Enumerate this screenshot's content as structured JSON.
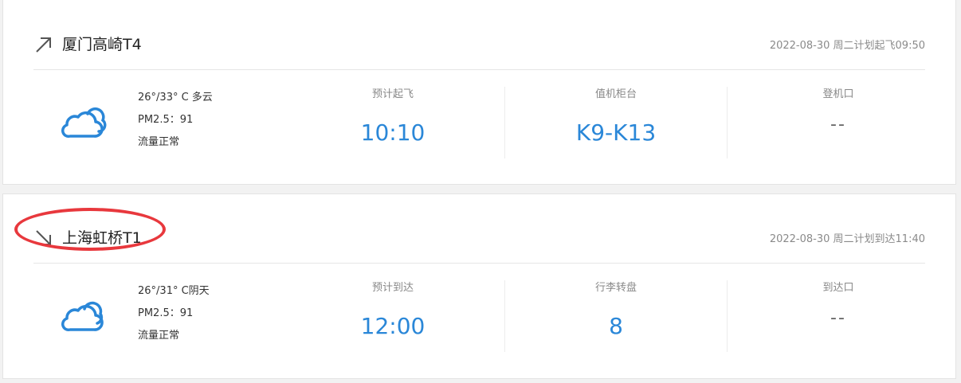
{
  "departure": {
    "airport": "厦门高崎T4",
    "schedule": "2022-08-30 周二计划起飞09:50",
    "weather": {
      "icon": "cloud-icon",
      "temperature": "26°/33° C 多云",
      "pm": "PM2.5：91",
      "traffic": "流量正常"
    },
    "columns": [
      {
        "label": "预计起飞",
        "value": "10:10"
      },
      {
        "label": "值机柜台",
        "value": "K9-K13"
      },
      {
        "label": "登机口",
        "value": "--"
      }
    ]
  },
  "arrival": {
    "airport": "上海虹桥T1",
    "schedule": "2022-08-30 周二计划到达11:40",
    "weather": {
      "icon": "cloud-icon",
      "temperature": "26°/31° C阴天",
      "pm": "PM2.5：91",
      "traffic": "流量正常"
    },
    "columns": [
      {
        "label": "预计到达",
        "value": "12:00"
      },
      {
        "label": "行李转盘",
        "value": "8"
      },
      {
        "label": "到达口",
        "value": "--"
      }
    ]
  },
  "colors": {
    "accent": "#2a87d8",
    "highlight": "#e8383d",
    "icon": "#555555"
  }
}
